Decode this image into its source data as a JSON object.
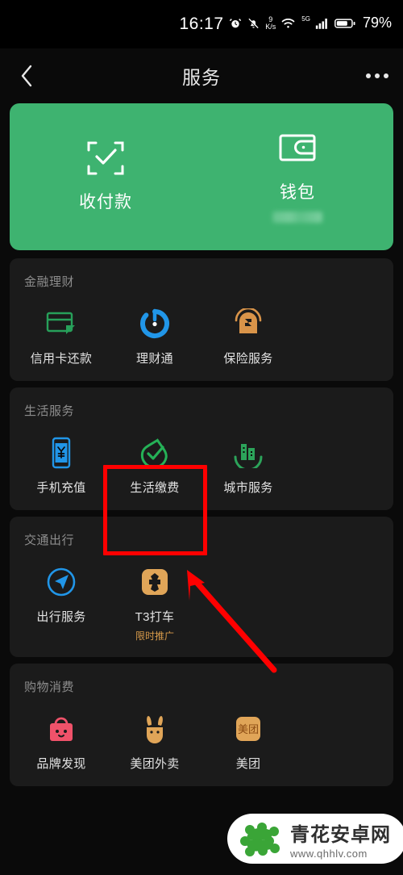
{
  "statusbar": {
    "time": "16:17",
    "alarm_icon": "alarm-icon",
    "mute_icon": "bell-muted-icon",
    "netspeed_value": "9",
    "netspeed_unit": "K/s",
    "wifi_icon": "wifi-icon",
    "network_tag": "5G",
    "signal_icon": "signal-bars-icon",
    "battery_icon": "battery-icon",
    "battery_percent": "79%"
  },
  "navbar": {
    "back_icon": "chevron-left-icon",
    "title": "服务",
    "more_icon": "more-options-icon"
  },
  "quick": {
    "items": [
      {
        "label": "收付款",
        "icon": "scan-pay-icon"
      },
      {
        "label": "钱包",
        "icon": "wallet-icon",
        "amount_hidden": true
      }
    ],
    "bg_color": "#3eb370"
  },
  "sections": [
    {
      "title": "金融理财",
      "items": [
        {
          "label": "信用卡还款",
          "icon": "credit-card-icon",
          "color": "#27a05a"
        },
        {
          "label": "理财通",
          "icon": "licaitong-icon",
          "color": "#2196e8"
        },
        {
          "label": "保险服务",
          "icon": "insurance-icon",
          "color": "#d99449"
        }
      ]
    },
    {
      "title": "生活服务",
      "items": [
        {
          "label": "手机充值",
          "icon": "phone-recharge-icon",
          "color": "#2196e8"
        },
        {
          "label": "生活缴费",
          "icon": "life-payment-icon",
          "color": "#25b157",
          "highlighted": true
        },
        {
          "label": "城市服务",
          "icon": "city-service-icon",
          "color": "#2ca35a"
        }
      ]
    },
    {
      "title": "交通出行",
      "items": [
        {
          "label": "出行服务",
          "icon": "travel-service-icon",
          "color": "#2196e8"
        },
        {
          "label": "T3打车",
          "icon": "t3-taxi-icon",
          "color": "#e0a558",
          "sub": "限时推广"
        }
      ]
    },
    {
      "title": "购物消费",
      "items": [
        {
          "label": "品牌发现",
          "icon": "brand-discovery-icon",
          "color": "#f0526a"
        },
        {
          "label": "美团外卖",
          "icon": "meituan-waimai-icon",
          "color": "#e0a558"
        },
        {
          "label": "美团",
          "icon": "meituan-icon",
          "color": "#e0a558"
        }
      ]
    }
  ],
  "annotation": {
    "box_color": "#ff0000",
    "arrow_color": "#ff0000",
    "target_label": "生活缴费"
  },
  "watermark": {
    "name": "青花安卓网",
    "url": "www.qhhlv.com",
    "logo_color": "#3aa537"
  }
}
